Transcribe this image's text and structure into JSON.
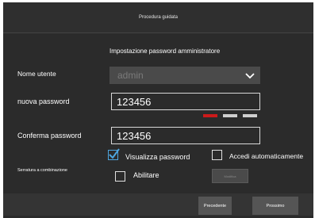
{
  "title": "Procedura guidata",
  "subtitle": "Impostazione password amministratore",
  "username": {
    "label": "Nome utente",
    "value": "admin",
    "icon": "chevron-down-icon"
  },
  "new_password": {
    "label": "nuova password",
    "value": "123456",
    "strength_level": 1,
    "strength_max": 3,
    "strength_colors": [
      "#cc1a1a",
      "#cfcfcf",
      "#cfcfcf"
    ]
  },
  "confirm_password": {
    "label": "Conferma password",
    "value": "123456"
  },
  "show_password": {
    "label": "Visualizza password",
    "checked": true
  },
  "auto_login": {
    "label": "Accedi automaticamente",
    "checked": false
  },
  "combination_lock": {
    "label": "Serratura a combinazione",
    "enable_label": "Abilitare",
    "enabled": false,
    "button_label": "Modifica"
  },
  "footer": {
    "previous_label": "Precedente",
    "next_label": "Prossimo"
  },
  "colors": {
    "background": "#2b2b2b",
    "accent_checkbox": "#4da6e0",
    "button": "#555555"
  }
}
